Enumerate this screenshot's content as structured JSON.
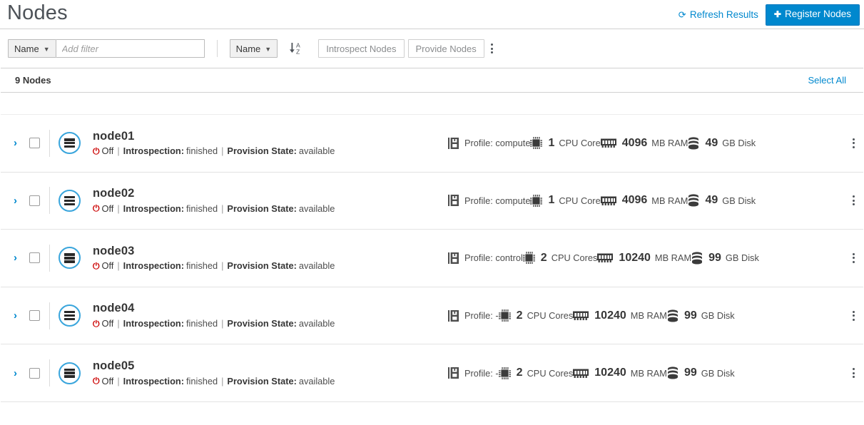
{
  "header": {
    "title": "Nodes",
    "refresh_label": "Refresh Results",
    "refresh_icon": "refresh-icon",
    "register_label": "Register Nodes",
    "register_icon": "plus-icon"
  },
  "toolbar": {
    "filter_field_label": "Name",
    "filter_placeholder": "Add filter",
    "filter_value": "",
    "sort_field_label": "Name",
    "sort_icon": "sort-alpha-asc-icon",
    "introspect_label": "Introspect Nodes",
    "provide_label": "Provide Nodes",
    "overflow_icon": "kebab-menu-icon"
  },
  "listheader": {
    "count_label": "9 Nodes",
    "select_all_label": "Select All"
  },
  "colors": {
    "accent": "#0088ce",
    "node_ring": "#39a5dc",
    "power_off": "#cc0000",
    "text": "#363636",
    "muted": "#8b8d8f"
  },
  "labels": {
    "power_state": "Off",
    "introspection_label": "Introspection:",
    "provision_label": "Provision State:",
    "profile_prefix": "Profile:",
    "cpu_unit_singular": "CPU Core",
    "cpu_unit_plural": "CPU Cores",
    "ram_unit": "MB RAM",
    "disk_unit": "GB Disk",
    "separator": "|"
  },
  "nodes": [
    {
      "name": "node01",
      "power": "Off",
      "introspection": "finished",
      "provision_state": "available",
      "profile": "compute",
      "cpu": "1",
      "cpu_unit": "CPU Core",
      "ram": "4096",
      "ram_unit": "MB RAM",
      "disk": "49",
      "disk_unit": "GB Disk"
    },
    {
      "name": "node02",
      "power": "Off",
      "introspection": "finished",
      "provision_state": "available",
      "profile": "compute",
      "cpu": "1",
      "cpu_unit": "CPU Core",
      "ram": "4096",
      "ram_unit": "MB RAM",
      "disk": "49",
      "disk_unit": "GB Disk"
    },
    {
      "name": "node03",
      "power": "Off",
      "introspection": "finished",
      "provision_state": "available",
      "profile": "control",
      "cpu": "2",
      "cpu_unit": "CPU Cores",
      "ram": "10240",
      "ram_unit": "MB RAM",
      "disk": "99",
      "disk_unit": "GB Disk"
    },
    {
      "name": "node04",
      "power": "Off",
      "introspection": "finished",
      "provision_state": "available",
      "profile": "-",
      "cpu": "2",
      "cpu_unit": "CPU Cores",
      "ram": "10240",
      "ram_unit": "MB RAM",
      "disk": "99",
      "disk_unit": "GB Disk"
    },
    {
      "name": "node05",
      "power": "Off",
      "introspection": "finished",
      "provision_state": "available",
      "profile": "-",
      "cpu": "2",
      "cpu_unit": "CPU Cores",
      "ram": "10240",
      "ram_unit": "MB RAM",
      "disk": "99",
      "disk_unit": "GB Disk"
    }
  ]
}
